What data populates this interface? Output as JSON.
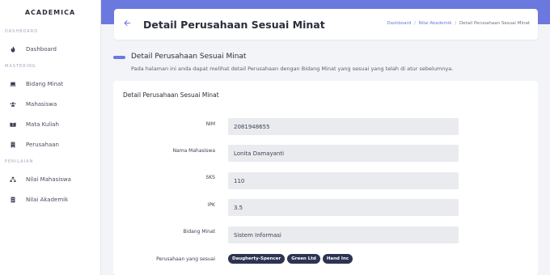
{
  "sidebar": {
    "brand": "ACADEMICA",
    "sections": [
      {
        "label": "DASHBOARD",
        "items": [
          {
            "label": "Dashboard",
            "icon": "flame-icon"
          }
        ]
      },
      {
        "label": "MASTERING",
        "items": [
          {
            "label": "Bidang Minat",
            "icon": "laptop-icon"
          },
          {
            "label": "Mahasiswa",
            "icon": "users-icon"
          },
          {
            "label": "Mata Kuliah",
            "icon": "book-icon"
          },
          {
            "label": "Perusahaan",
            "icon": "building-icon"
          }
        ]
      },
      {
        "label": "PENILAIAN",
        "items": [
          {
            "label": "Nilai Mahasiswa",
            "icon": "sitemap-icon"
          },
          {
            "label": "Nilai Akademik",
            "icon": "document-icon"
          }
        ]
      }
    ]
  },
  "header": {
    "title": "Detail Perusahaan Sesuai Minat",
    "back_icon": "arrow-left-icon",
    "breadcrumb": {
      "items": [
        "Dashboard",
        "Nilai Akademik",
        "Detail Perusahaan Sesuai Minat"
      ],
      "separator": "/"
    }
  },
  "section": {
    "title": "Detail Perusahaan Sesuai Minat",
    "description": "Pada halaman ini anda dapat melihat detail Perusahaan dengan Bidang Minat yang sesuai yang telah di atur sebelumnya."
  },
  "card": {
    "title": "Detail Perusahaan Sesuai Minat",
    "fields": {
      "nim": {
        "label": "NIM",
        "value": "2081948655"
      },
      "nama": {
        "label": "Nama Mahasiswa",
        "value": "Lonita Damayanti"
      },
      "sks": {
        "label": "SKS",
        "value": "110"
      },
      "ipk": {
        "label": "IPK",
        "value": "3.5"
      },
      "bidang": {
        "label": "Bidang Minat",
        "value": "Sistem Informasi"
      }
    },
    "perusahaan_label": "Perusahaan yang sesuai",
    "perusahaan": [
      "Daugherty-Spencer",
      "Green Ltd",
      "Hand Inc"
    ]
  },
  "colors": {
    "accent": "#6b78de",
    "badge": "#2d3352",
    "input_bg": "#e9ebee",
    "page_bg": "#f3f4f8"
  }
}
